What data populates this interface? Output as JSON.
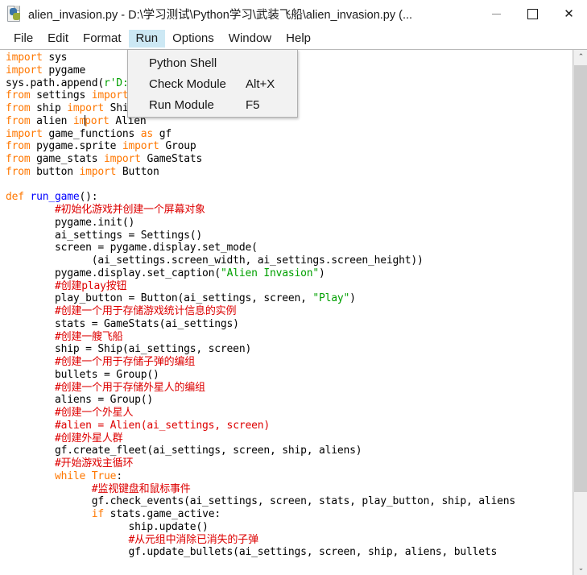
{
  "window": {
    "title": "alien_invasion.py - D:\\学习测试\\Python学习\\武装飞船\\alien_invasion.py (...",
    "icon": "python-file-icon",
    "minimize_label": "—",
    "maximize_label": "□",
    "close_label": "✕"
  },
  "menubar": {
    "items": [
      {
        "label": "File",
        "active": false
      },
      {
        "label": "Edit",
        "active": false
      },
      {
        "label": "Format",
        "active": false
      },
      {
        "label": "Run",
        "active": true
      },
      {
        "label": "Options",
        "active": false
      },
      {
        "label": "Window",
        "active": false
      },
      {
        "label": "Help",
        "active": false
      }
    ]
  },
  "run_menu": {
    "open": true,
    "items": [
      {
        "label": "Python Shell",
        "accel": ""
      },
      {
        "label": "Check Module",
        "accel": "Alt+X"
      },
      {
        "label": "Run Module",
        "accel": "F5"
      }
    ]
  },
  "scrollbar": {
    "up_arrow": "⌃",
    "down_arrow": "⌄"
  },
  "editor": {
    "colors": {
      "keyword": "#ff7700",
      "definition": "#0000ff",
      "string": "#00a000",
      "comment": "#dd0000",
      "text": "#000000",
      "background": "#ffffff",
      "menu_highlight": "#cce8f4"
    },
    "lines": [
      "import sys",
      "import pygame",
      "sys.path.append(r'D:\\学习测试\\Python学习\\武装飞船')",
      "from settings import Settings",
      "from ship import Ship",
      "from alien import Alien",
      "import game_functions as gf",
      "from pygame.sprite import Group",
      "from game_stats import GameStats",
      "from button import Button",
      "",
      "def run_game():",
      "        #初始化游戏并创建一个屏幕对象",
      "        pygame.init()",
      "        ai_settings = Settings()",
      "        screen = pygame.display.set_mode(",
      "              (ai_settings.screen_width, ai_settings.screen_height))",
      "        pygame.display.set_caption(\"Alien Invasion\")",
      "        #创建play按钮",
      "        play_button = Button(ai_settings, screen, \"Play\")",
      "        #创建一个用于存储游戏统计信息的实例",
      "        stats = GameStats(ai_settings)",
      "        #创建一艘飞船",
      "        ship = Ship(ai_settings, screen)",
      "        #创建一个用于存储子弹的编组",
      "        bullets = Group()",
      "        #创建一个用于存储外星人的编组",
      "        aliens = Group()",
      "        #创建一个外星人",
      "        #alien = Alien(ai_settings, screen)",
      "        #创建外星人群",
      "        gf.create_fleet(ai_settings, screen, ship, aliens)",
      "        #开始游戏主循环",
      "        while True:",
      "              #监视键盘和鼠标事件",
      "              gf.check_events(ai_settings, screen, stats, play_button, ship, aliens",
      "              if stats.game_active:",
      "                    ship.update()",
      "                    #从元组中消除已消失的子弹",
      "                    gf.update_bullets(ai_settings, screen, ship, aliens, bullets"
    ]
  }
}
